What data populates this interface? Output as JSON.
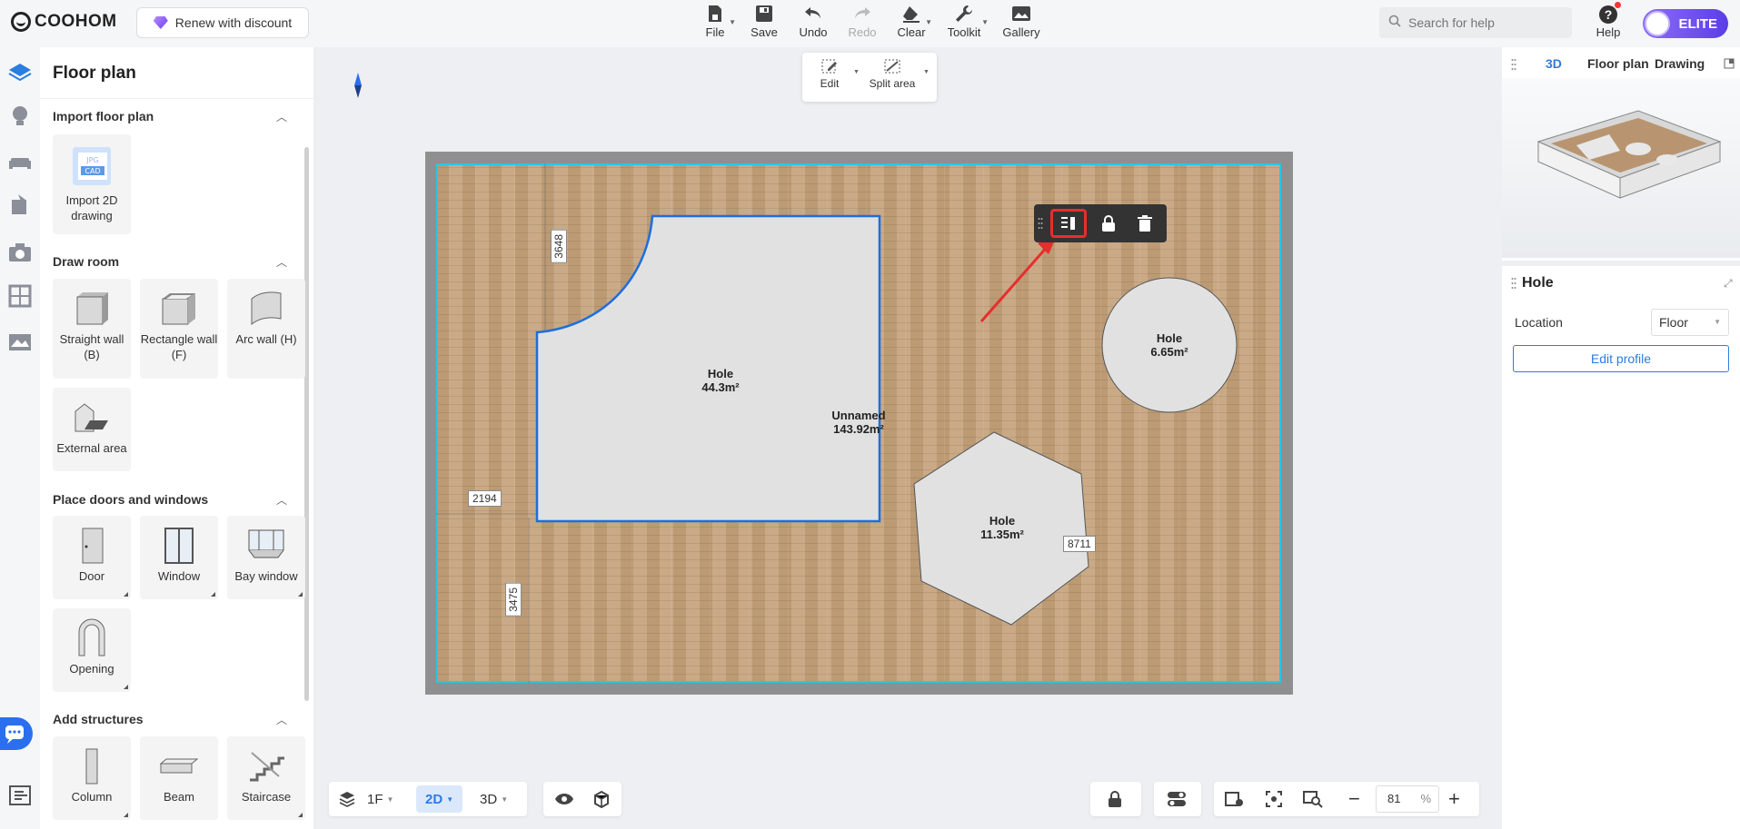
{
  "app": {
    "brand": "COOHOM",
    "renew_label": "Renew with discount",
    "badge": "ELITE"
  },
  "toolbar": {
    "file": "File",
    "save": "Save",
    "undo": "Undo",
    "redo": "Redo",
    "clear": "Clear",
    "toolkit": "Toolkit",
    "gallery": "Gallery"
  },
  "search": {
    "placeholder": "Search for help"
  },
  "help": {
    "label": "Help"
  },
  "left_panel": {
    "title": "Floor plan",
    "sections": {
      "import": {
        "title": "Import floor plan",
        "items": [
          "Import 2D drawing"
        ]
      },
      "draw": {
        "title": "Draw room",
        "items": [
          "Straight wall (B)",
          "Rectangle wall (F)",
          "Arc wall (H)",
          "External area"
        ]
      },
      "doors": {
        "title": "Place doors and windows",
        "items": [
          "Door",
          "Window",
          "Bay window",
          "Opening"
        ]
      },
      "structures": {
        "title": "Add structures",
        "items": [
          "Column",
          "Beam",
          "Staircase"
        ]
      }
    }
  },
  "float_bar": {
    "edit": "Edit",
    "split": "Split area"
  },
  "canvas": {
    "rooms": [
      {
        "name": "Hole",
        "area": "44.3m²"
      },
      {
        "name": "Unnamed",
        "area": "143.92m²"
      },
      {
        "name": "Hole",
        "area": "6.65m²"
      },
      {
        "name": "Hole",
        "area": "11.35m²"
      }
    ],
    "dimensions": {
      "d1": "3648",
      "d2": "2194",
      "d3": "3475",
      "d4": "8711"
    }
  },
  "right_panel": {
    "tabs": [
      "3D",
      "Floor plan",
      "Drawing"
    ],
    "active_tab": "3D",
    "selection_title": "Hole",
    "location_label": "Location",
    "location_value": "Floor",
    "edit_profile": "Edit profile"
  },
  "bottom_bar": {
    "floor": "1F",
    "view_2d": "2D",
    "view_3d": "3D",
    "zoom_value": "81",
    "zoom_unit": "%"
  },
  "colors": {
    "accent": "#2a7de1",
    "selection_outline": "#25c8e8",
    "highlight": "#e62e2e",
    "elite": "#6a4cf0"
  }
}
